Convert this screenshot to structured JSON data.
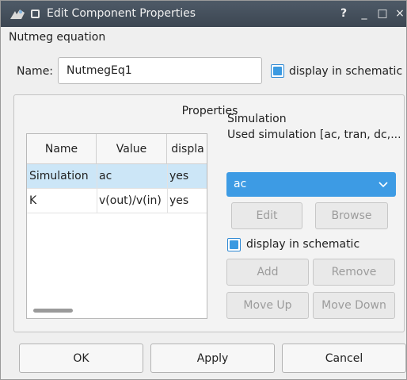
{
  "window": {
    "title": "Edit Component Properties",
    "help_label": "?",
    "minimize_label": "_",
    "maximize_label": "□",
    "close_label": "×"
  },
  "component_title": "Nutmeg equation",
  "name_field": {
    "label": "Name:",
    "value": "NutmegEq1",
    "display_in_schematic": "display in schematic",
    "checked": true
  },
  "properties": {
    "group_title": "Properties",
    "columns": [
      "Name",
      "Value",
      "displa"
    ],
    "rows": [
      {
        "name": "Simulation",
        "value": "ac",
        "display": "yes",
        "selected": true
      },
      {
        "name": "K",
        "value": "v(out)/v(in)",
        "display": "yes",
        "selected": false
      }
    ]
  },
  "editor": {
    "title": "Simulation",
    "description": "Used simulation [ac, tran, dc,....",
    "selected_value": "ac",
    "edit_label": "Edit",
    "browse_label": "Browse",
    "display_in_schematic": "display in schematic",
    "checked": true,
    "add_label": "Add",
    "remove_label": "Remove",
    "move_up_label": "Move Up",
    "move_down_label": "Move Down"
  },
  "buttons": {
    "ok": "OK",
    "apply": "Apply",
    "cancel": "Cancel"
  },
  "colors": {
    "accent": "#3d9be4",
    "selected_row": "#cce6f7",
    "titlebar": "#46515d"
  }
}
